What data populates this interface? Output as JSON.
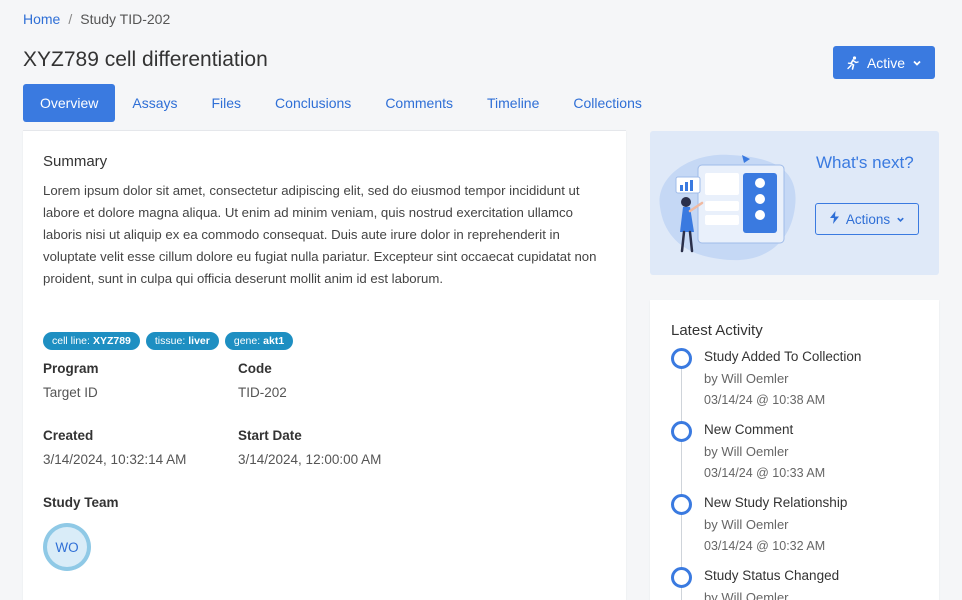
{
  "breadcrumb": {
    "home": "Home",
    "separator": "/",
    "current": "Study TID-202"
  },
  "page": {
    "title": "XYZ789 cell differentiation"
  },
  "status_button": {
    "label": "Active",
    "icon": "running-person-icon"
  },
  "tabs": [
    {
      "label": "Overview",
      "active": true
    },
    {
      "label": "Assays"
    },
    {
      "label": "Files"
    },
    {
      "label": "Conclusions"
    },
    {
      "label": "Comments"
    },
    {
      "label": "Timeline"
    },
    {
      "label": "Collections"
    }
  ],
  "summary": {
    "title": "Summary",
    "text": "Lorem ipsum dolor sit amet, consectetur adipiscing elit, sed do eiusmod tempor incididunt ut labore et dolore magna aliqua. Ut enim ad minim veniam, quis nostrud exercitation ullamco laboris nisi ut aliquip ex ea commodo consequat. Duis aute irure dolor in reprehenderit in voluptate velit esse cillum dolore eu fugiat nulla pariatur. Excepteur sint occaecat cupidatat non proident, sunt in culpa qui officia deserunt mollit anim id est laborum."
  },
  "tags": [
    {
      "key": "cell line:",
      "value": "XYZ789"
    },
    {
      "key": "tissue:",
      "value": "liver"
    },
    {
      "key": "gene:",
      "value": "akt1"
    }
  ],
  "fields": {
    "program": {
      "label": "Program",
      "value": "Target ID"
    },
    "code": {
      "label": "Code",
      "value": "TID-202"
    },
    "created": {
      "label": "Created",
      "value": "3/14/2024, 10:32:14 AM"
    },
    "start_date": {
      "label": "Start Date",
      "value": "3/14/2024, 12:00:00 AM"
    }
  },
  "team": {
    "label": "Study Team",
    "members": [
      {
        "initials": "WO"
      }
    ]
  },
  "whats_next": {
    "title": "What's next?",
    "actions_label": "Actions"
  },
  "activity": {
    "title": "Latest Activity",
    "items": [
      {
        "name": "Study Added To Collection",
        "by": "by Will Oemler",
        "time": "03/14/24 @ 10:38 AM"
      },
      {
        "name": "New Comment",
        "by": "by Will Oemler",
        "time": "03/14/24 @ 10:33 AM"
      },
      {
        "name": "New Study Relationship",
        "by": "by Will Oemler",
        "time": "03/14/24 @ 10:32 AM"
      },
      {
        "name": "Study Status Changed",
        "by": "by Will Oemler",
        "time": ""
      }
    ]
  },
  "colors": {
    "accent": "#3a7ae0",
    "link": "#2f6fd6",
    "tag": "#1e8fc2",
    "panel": "#dfe9f8"
  }
}
